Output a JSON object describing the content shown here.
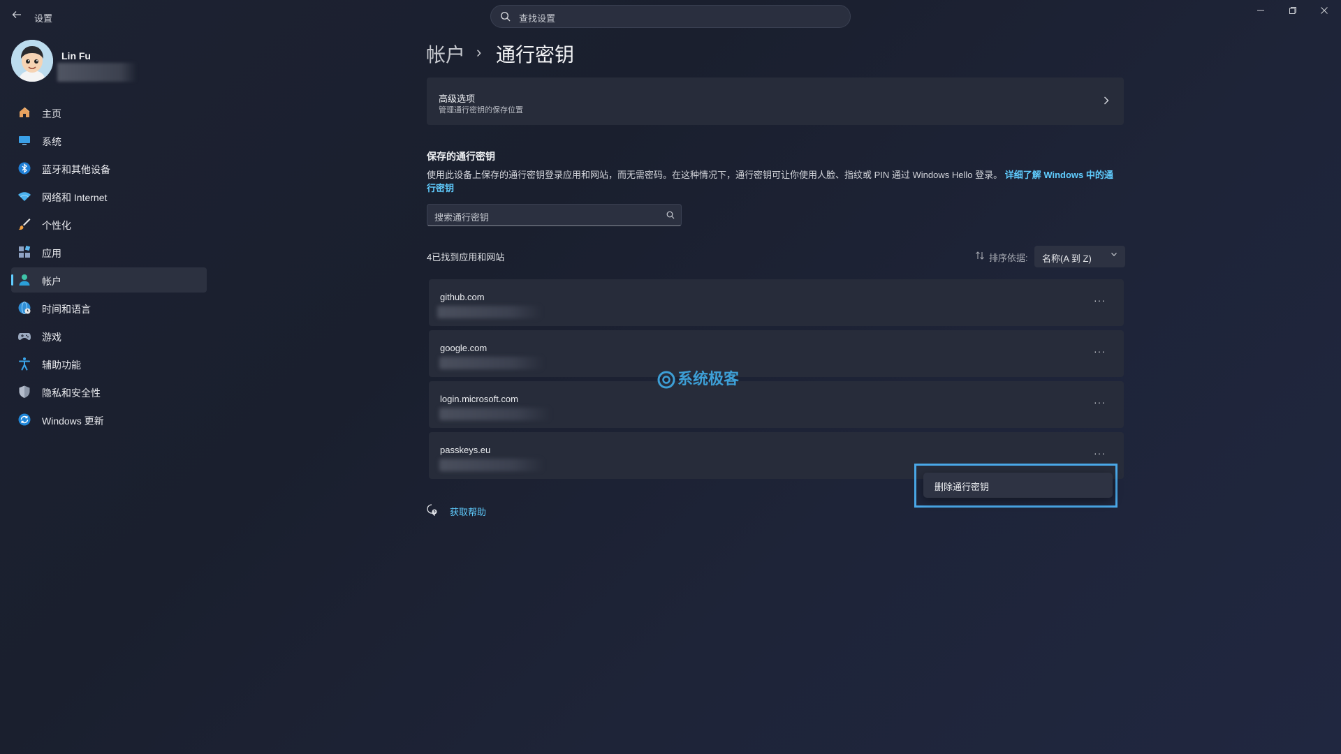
{
  "window": {
    "app_title": "设置",
    "search_placeholder": "查找设置",
    "controls": [
      "minimize",
      "restore",
      "close"
    ]
  },
  "profile": {
    "name": "Lin Fu"
  },
  "sidebar": {
    "items": [
      {
        "label": "主页",
        "icon": "home-icon"
      },
      {
        "label": "系统",
        "icon": "system-icon"
      },
      {
        "label": "蓝牙和其他设备",
        "icon": "bluetooth-icon"
      },
      {
        "label": "网络和 Internet",
        "icon": "wifi-icon"
      },
      {
        "label": "个性化",
        "icon": "brush-icon"
      },
      {
        "label": "应用",
        "icon": "apps-icon"
      },
      {
        "label": "帐户",
        "icon": "account-icon",
        "active": true
      },
      {
        "label": "时间和语言",
        "icon": "globe-clock-icon"
      },
      {
        "label": "游戏",
        "icon": "gamepad-icon"
      },
      {
        "label": "辅助功能",
        "icon": "accessibility-icon"
      },
      {
        "label": "隐私和安全性",
        "icon": "shield-icon"
      },
      {
        "label": "Windows 更新",
        "icon": "update-icon"
      }
    ]
  },
  "breadcrumb": {
    "parent": "帐户",
    "separator": "›",
    "current": "通行密钥"
  },
  "advanced": {
    "title": "高级选项",
    "subtitle": "管理通行密钥的保存位置"
  },
  "saved": {
    "title": "保存的通行密钥",
    "description": "使用此设备上保存的通行密钥登录应用和网站，而无需密码。在这种情况下，通行密钥可让你使用人脸、指纹或 PIN 通过 Windows Hello 登录。",
    "learn_more": "详细了解 Windows 中的通行密钥",
    "search_placeholder": "搜索通行密钥",
    "found_count": "4已找到应用和网站",
    "sort_label": "排序依据:",
    "sort_value": "名称(A 到 Z)"
  },
  "passkeys": [
    {
      "site": "github.com"
    },
    {
      "site": "google.com"
    },
    {
      "site": "login.microsoft.com"
    },
    {
      "site": "passkeys.eu"
    }
  ],
  "more_glyph": "···",
  "context_menu": {
    "item": "删除通行密钥"
  },
  "help": {
    "label": "获取帮助"
  },
  "watermark": {
    "text": "系统极客"
  },
  "colors": {
    "accent": "#60cdff",
    "highlight_border": "#4aa8e8",
    "card_bg": "#272c3a"
  }
}
